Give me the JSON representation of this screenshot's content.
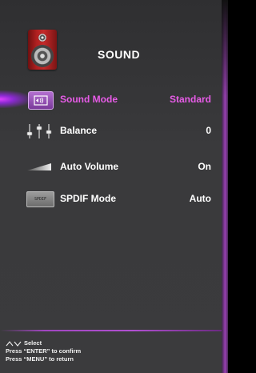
{
  "header": {
    "title": "SOUND",
    "icon": "speaker-icon"
  },
  "menu": {
    "items": [
      {
        "label": "Sound Mode",
        "value": "Standard",
        "icon": "sound-mode-icon",
        "selected": true
      },
      {
        "label": "Balance",
        "value": "0",
        "icon": "balance-icon",
        "selected": false
      },
      {
        "label": "Auto Volume",
        "value": "On",
        "icon": "auto-volume-icon",
        "selected": false
      },
      {
        "label": "SPDIF Mode",
        "value": "Auto",
        "icon": "spdif-icon",
        "icon_text": "SPDIF",
        "selected": false
      }
    ]
  },
  "footer": {
    "select_label": "Select",
    "confirm_text": "Press “ENTER” to confirm",
    "return_text": "Press “MENU” to return"
  },
  "colors": {
    "selected_text": "#e85ce8",
    "accent": "#a046c0",
    "background": "#3a3a3c"
  }
}
